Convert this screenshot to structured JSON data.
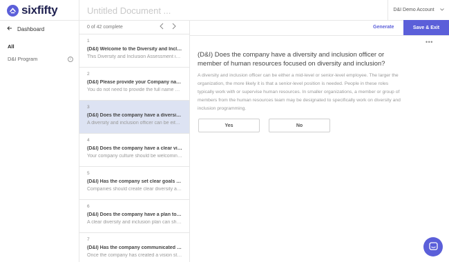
{
  "brand": {
    "name": "sixfifty",
    "color": "#5b5fd9"
  },
  "sidebar": {
    "back_label": "Dashboard",
    "back_icon": "arrow-left-icon",
    "nav": [
      {
        "label": "All",
        "active": true
      },
      {
        "label": "D&I Program",
        "icon": "info-icon"
      }
    ]
  },
  "header": {
    "document_title_placeholder": "Untitled Document ...",
    "account_label": "D&I Demo Account",
    "account_icon": "chevron-down-icon"
  },
  "progress": {
    "label": "0 of 42 complete",
    "completed": 0,
    "total": 42
  },
  "questions": [
    {
      "num": "1",
      "title": "(D&I) Welcome to the Diversity and Inclusion Assessment",
      "desc": "This Diversity and Inclusion Assessment is designed to help"
    },
    {
      "num": "2",
      "title": "(D&I) Please provide your Company name as it should appear",
      "desc": "You do not need to provide the full name of your company"
    },
    {
      "num": "3",
      "title": "(D&I) Does the company have a diversity and inclusion officer",
      "desc": "A diversity and inclusion officer can be either a mid-level",
      "active": true
    },
    {
      "num": "4",
      "title": "(D&I) Does the company have a clear vision for diversity",
      "desc": "Your company culture should be welcoming to everyone"
    },
    {
      "num": "5",
      "title": "(D&I) Has the company set clear goals to improve diversity",
      "desc": "Companies should create clear diversity and inclusion goals"
    },
    {
      "num": "6",
      "title": "(D&I) Does the company have a plan to implement",
      "desc": "A clear diversity and inclusion plan can show employees"
    },
    {
      "num": "7",
      "title": "(D&I) Has the company communicated its vision",
      "desc": "Once the company has created a vision statement"
    }
  ],
  "toolbar": {
    "generate_label": "Generate",
    "save_exit_label": "Save & Exit",
    "more_icon": "more-horizontal-icon"
  },
  "main": {
    "question": "(D&I) Does the company have a diversity and inclusion officer or member of human resources focused on diversity and inclusion?",
    "explanation": "A diversity and inclusion officer can be either a mid-level or senior-level employee. The larger the organization, the more likely it is that a senior-level position is needed. People in these roles typically work with or supervise human resources. In smaller organizations, a member or group of members from the human resources team may be designated to specifically work on diversity and inclusion programming.",
    "answers": [
      "Yes",
      "No"
    ]
  },
  "chat": {
    "icon": "chat-icon"
  }
}
